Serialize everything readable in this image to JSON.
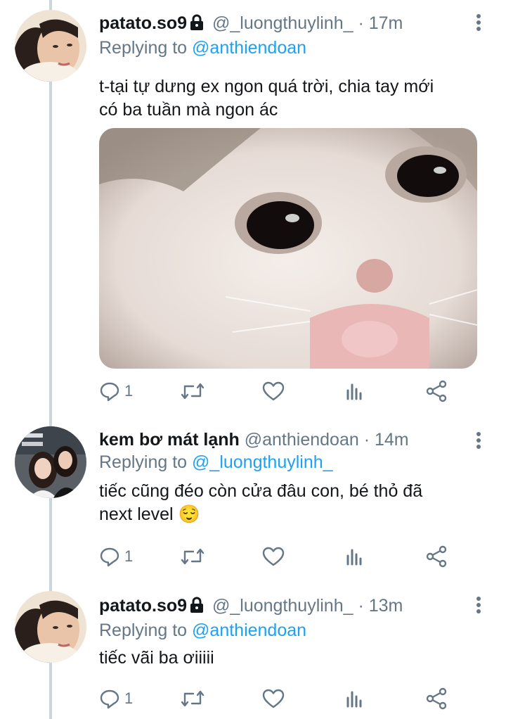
{
  "tweets": [
    {
      "name": "patato.so9",
      "protected": true,
      "handle": "@_luongthuylinh_",
      "time": "· 17m",
      "replying_label": "Replying to",
      "replying_to": "@anthiendoan",
      "text_lines": [
        "t-tại tự dưng ex ngon quá trời, chia tay mới",
        "có ba tuần mà ngon ác"
      ],
      "reply_count": "1"
    },
    {
      "name": "kem bơ mát lạnh",
      "protected": false,
      "handle": "@anthiendoan",
      "time": "· 14m",
      "replying_label": "Replying to",
      "replying_to": "@_luongthuylinh_",
      "text_lines": [
        "tiếc cũng đéo còn cửa đâu con, bé thỏ đã",
        "next level 😌"
      ],
      "reply_count": "1"
    },
    {
      "name": "patato.so9",
      "protected": true,
      "handle": "@_luongthuylinh_",
      "time": "· 13m",
      "replying_label": "Replying to",
      "replying_to": "@anthiendoan",
      "text_lines": [
        "tiếc vãi ba ơiiiii"
      ],
      "reply_count": "1"
    }
  ],
  "icons": {
    "reply": "reply-icon",
    "retweet": "retweet-icon",
    "like": "heart-icon",
    "analytics": "analytics-icon",
    "share": "share-icon",
    "lock": "lock-icon",
    "more": "more-options-icon"
  },
  "colors": {
    "accent": "#1da1f2",
    "secondary_text": "#657786",
    "thread_line": "#ccd6dd"
  }
}
